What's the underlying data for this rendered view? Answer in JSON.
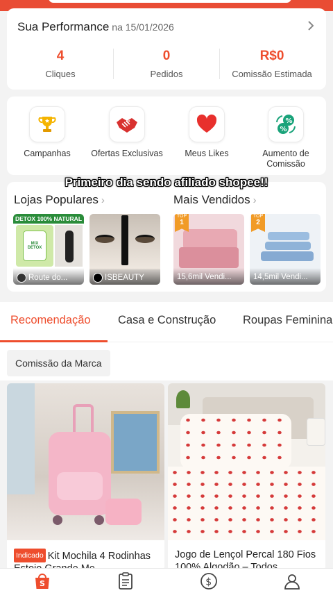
{
  "performance": {
    "title": "Sua Performance",
    "date": "na 15/01/2026",
    "stats": [
      {
        "value": "4",
        "label": "Cliques"
      },
      {
        "value": "0",
        "label": "Pedidos"
      },
      {
        "value": "R$0",
        "label": "Comissão Estimada"
      }
    ]
  },
  "shortcuts": [
    {
      "label": "Campanhas",
      "icon": "trophy-icon"
    },
    {
      "label": "Ofertas Exclusivas",
      "icon": "handshake-percent-icon"
    },
    {
      "label": "Meus Likes",
      "icon": "heart-icon"
    },
    {
      "label": "Aumento de Comissão",
      "icon": "percent-cycle-icon"
    }
  ],
  "caption": "Primeiro dia sendo afiliado shopee!!",
  "popular": {
    "stores_title": "Lojas Populares",
    "best_title": "Mais Vendidos",
    "stores": [
      {
        "name": "Route do...",
        "banner": "DETOX 100% NATURAL",
        "product": "MIX DETOX"
      },
      {
        "name": "ISBEAUTY"
      }
    ],
    "best": [
      {
        "rank_label": "TOP",
        "rank": "1",
        "sold": "15,6mil Vendi..."
      },
      {
        "rank_label": "TOP",
        "rank": "2",
        "sold": "14,5mil Vendi..."
      }
    ]
  },
  "tabs": [
    "Recomendação",
    "Casa e Construção",
    "Roupas Feminina"
  ],
  "chip": "Comissão da Marca",
  "products": [
    {
      "tag": "Indicado",
      "title": "Kit Mochila 4 Rodinhas Estojo Grande Me"
    },
    {
      "title": "Jogo de Lençol Percal 180 Fios 100% Algodão – Todos"
    }
  ],
  "colors": {
    "accent": "#ee4d2d",
    "topbar": "#e94c34"
  },
  "bottom_nav": [
    "shopee-bag-icon",
    "clipboard-icon",
    "dollar-circle-icon",
    "profile-icon"
  ]
}
